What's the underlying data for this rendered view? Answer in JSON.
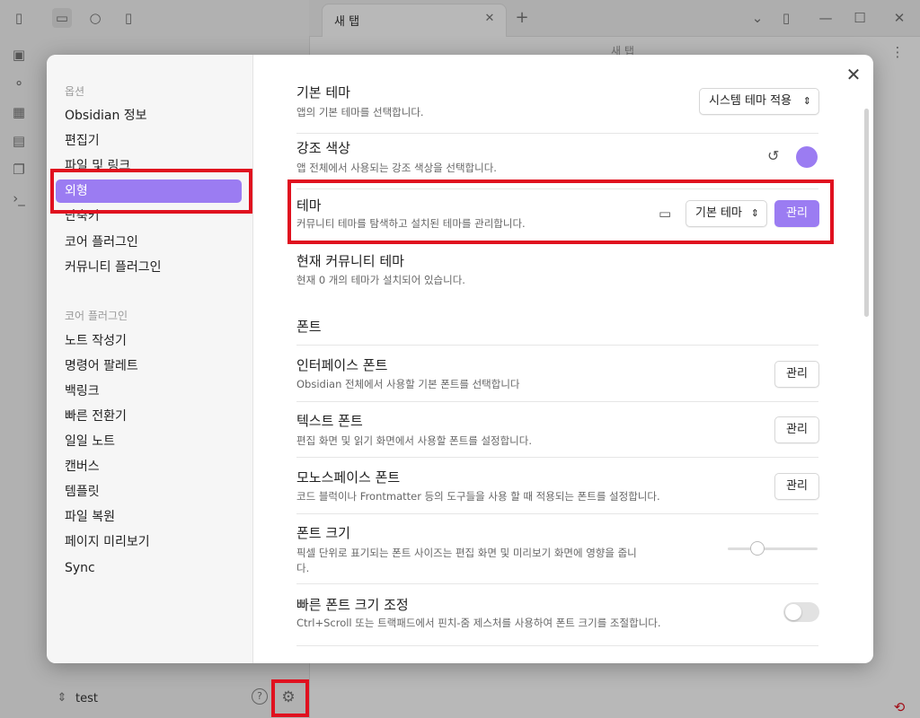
{
  "background": {
    "tab_title": "새 탭",
    "view_title": "새 탭",
    "vault_name": "test"
  },
  "modal": {
    "nav_options_heading": "옵션",
    "nav_options": [
      "Obsidian 정보",
      "편집기",
      "파일 및 링크",
      "외형",
      "단축키",
      "코어 플러그인",
      "커뮤니티 플러그인"
    ],
    "nav_core_heading": "코어 플러그인",
    "nav_core": [
      "노트 작성기",
      "명령어 팔레트",
      "백링크",
      "빠른 전환기",
      "일일 노트",
      "캔버스",
      "템플릿",
      "파일 복원",
      "페이지 미리보기",
      "Sync"
    ],
    "base_theme": {
      "title": "기본 테마",
      "desc": "앱의 기본 테마를 선택합니다.",
      "value": "시스템 테마 적용"
    },
    "accent": {
      "title": "강조 색상",
      "desc": "앱 전체에서 사용되는 강조 색상을 선택합니다.",
      "color": "#9b7cf2"
    },
    "theme": {
      "title": "테마",
      "desc": "커뮤니티 테마를 탐색하고 설치된 테마를 관리합니다.",
      "select_value": "기본 테마",
      "manage": "관리"
    },
    "current_theme": {
      "title": "현재 커뮤니티 테마",
      "desc": "현재 0 개의 테마가 설치되어 있습니다."
    },
    "font_heading": "폰트",
    "interface_font": {
      "title": "인터페이스 폰트",
      "desc": "Obsidian 전체에서 사용할 기본 폰트를 선택합니다",
      "button": "관리"
    },
    "text_font": {
      "title": "텍스트 폰트",
      "desc": "편집 화면 및 읽기 화면에서 사용할 폰트를 설정합니다.",
      "button": "관리"
    },
    "mono_font": {
      "title": "모노스페이스 폰트",
      "desc": "코드 블럭이나 Frontmatter 등의 도구들을 사용 할 때 적용되는 폰트를 설정합니다.",
      "button": "관리"
    },
    "font_size": {
      "title": "폰트 크기",
      "desc_line1": "픽셀 단위로 표기되는 폰트 사이즈는 편집 화면 및 미리보기 화면에 영향을 줍니",
      "desc_line2": "다.",
      "slider_fraction": 0.33
    },
    "quick_font": {
      "title": "빠른 폰트 크기 조정",
      "desc": "Ctrl+Scroll 또는 트랙패드에서 핀치-줌 제스처를 사용하여 폰트 크기를 조절합니다.",
      "enabled": false
    }
  },
  "highlight_color": "#e0111f"
}
